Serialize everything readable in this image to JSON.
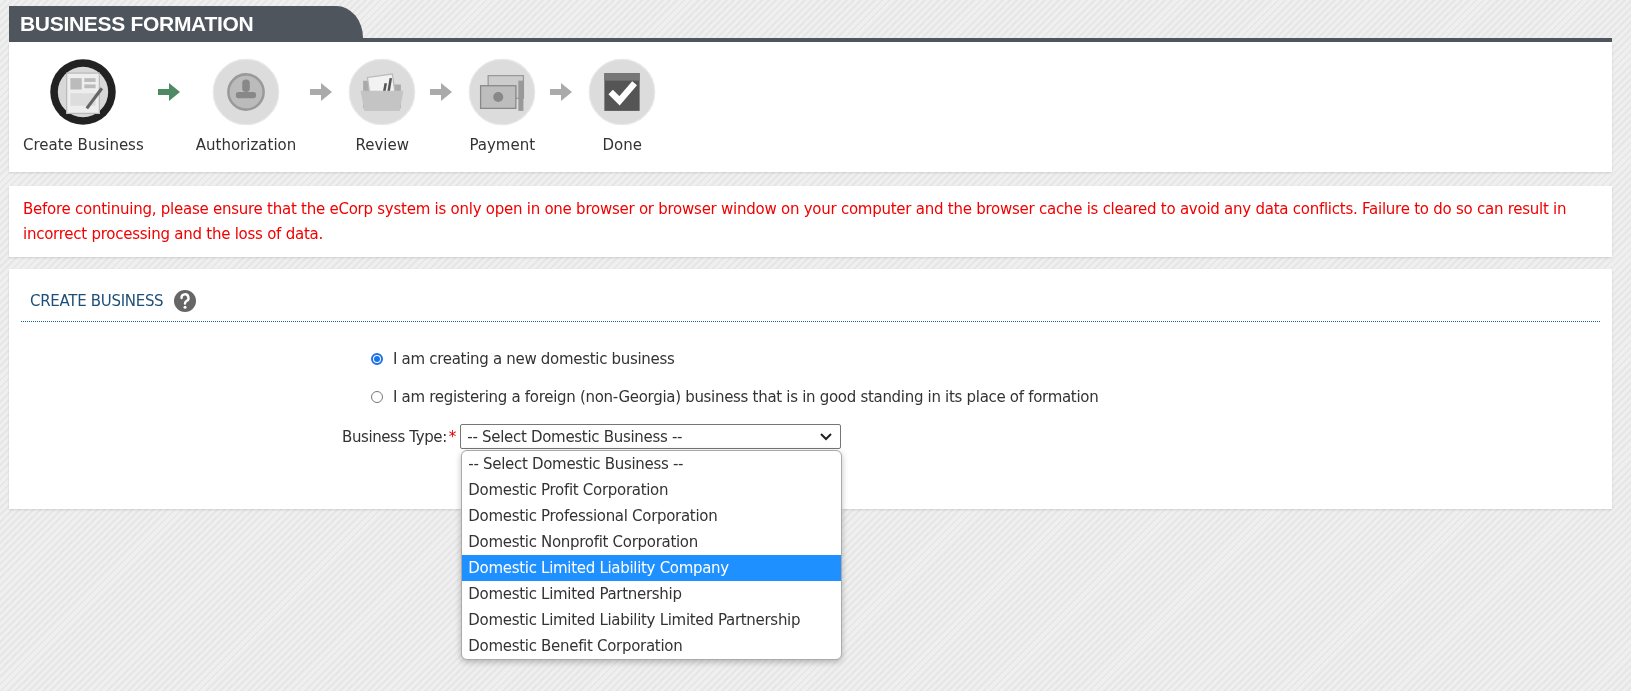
{
  "header": {
    "title": "BUSINESS FORMATION"
  },
  "steps": [
    {
      "label": "Create Business",
      "kind": "form",
      "selected": true
    },
    {
      "label": "Authorization",
      "kind": "stamp",
      "selected": false
    },
    {
      "label": "Review",
      "kind": "folder",
      "selected": false
    },
    {
      "label": "Payment",
      "kind": "money",
      "selected": false
    },
    {
      "label": "Done",
      "kind": "check",
      "selected": false
    }
  ],
  "warning": "Before continuing, please ensure that the eCorp system is only open in one browser or browser window on your computer and the browser cache is cleared to avoid any data conflicts. Failure to do so can result in incorrect processing and the loss of data.",
  "section": {
    "title": "CREATE BUSINESS",
    "radios": [
      {
        "label": "I am creating a new domestic business",
        "selected": true
      },
      {
        "label": "I am registering a foreign (non-Georgia) business that is in good standing in its place of formation",
        "selected": false
      }
    ],
    "business_type": {
      "label": "Business Type:",
      "required_mark": "*",
      "value": "-- Select Domestic Business --",
      "expanded": true,
      "options": [
        {
          "label": "-- Select Domestic Business --",
          "highlighted": false
        },
        {
          "label": "Domestic Profit Corporation",
          "highlighted": false
        },
        {
          "label": "Domestic Professional Corporation",
          "highlighted": false
        },
        {
          "label": "Domestic Nonprofit Corporation",
          "highlighted": false
        },
        {
          "label": "Domestic Limited Liability Company",
          "highlighted": true
        },
        {
          "label": "Domestic Limited Partnership",
          "highlighted": false
        },
        {
          "label": "Domestic Limited Liability Limited Partnership",
          "highlighted": false
        },
        {
          "label": "Domestic Benefit Corporation",
          "highlighted": false
        }
      ]
    }
  }
}
